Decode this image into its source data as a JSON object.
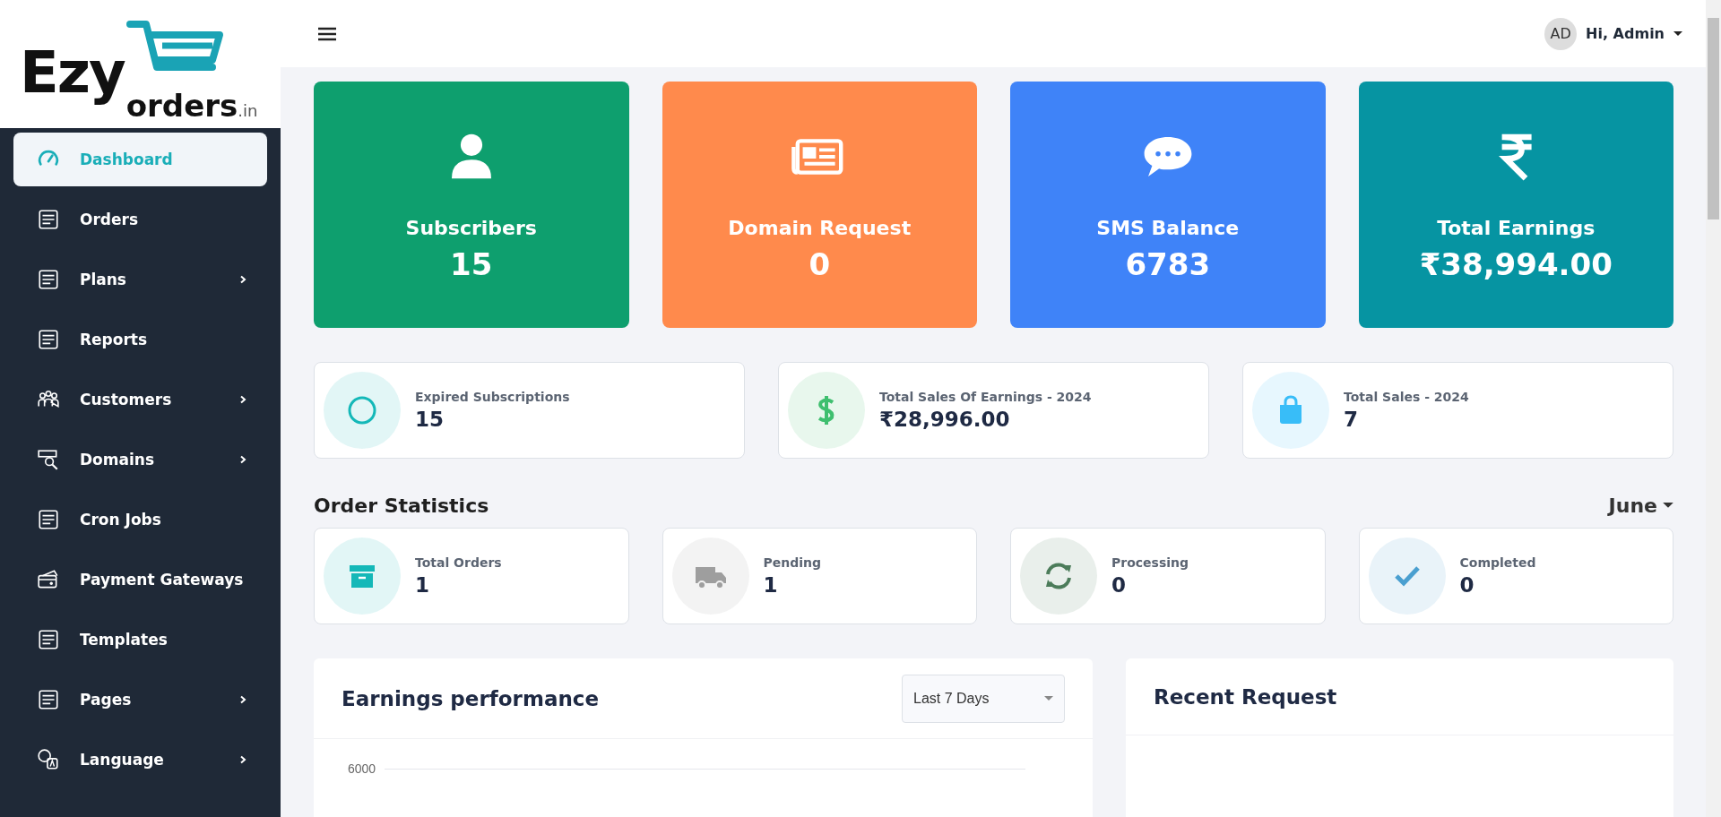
{
  "logo": {
    "word_1": "Ezy",
    "word_2": "orders",
    "suffix": ".in"
  },
  "sidebar": {
    "items": [
      {
        "label": "Dashboard",
        "selected": true,
        "has_submenu": false
      },
      {
        "label": "Orders",
        "selected": false,
        "has_submenu": false
      },
      {
        "label": "Plans",
        "selected": false,
        "has_submenu": true
      },
      {
        "label": "Reports",
        "selected": false,
        "has_submenu": false
      },
      {
        "label": "Customers",
        "selected": false,
        "has_submenu": true
      },
      {
        "label": "Domains",
        "selected": false,
        "has_submenu": true
      },
      {
        "label": "Cron Jobs",
        "selected": false,
        "has_submenu": false
      },
      {
        "label": "Payment Gateways",
        "selected": false,
        "has_submenu": false
      },
      {
        "label": "Templates",
        "selected": false,
        "has_submenu": false
      },
      {
        "label": "Pages",
        "selected": false,
        "has_submenu": true
      },
      {
        "label": "Language",
        "selected": false,
        "has_submenu": true
      }
    ]
  },
  "header": {
    "avatar": "AD",
    "greeting": "Hi, Admin"
  },
  "summary_cards": [
    {
      "label": "Subscribers",
      "value": "15",
      "color": "#0e9f6e"
    },
    {
      "label": "Domain Request",
      "value": "0",
      "color": "#ff8a4c"
    },
    {
      "label": "SMS Balance",
      "value": "6783",
      "color": "#3f83f8"
    },
    {
      "label": "Total Earnings",
      "value": "₹38,994.00",
      "color": "#0694a2"
    }
  ],
  "stats": [
    {
      "label": "Expired Subscriptions",
      "value": "15",
      "color": "#14b8b8"
    },
    {
      "label": "Total Sales Of Earnings - 2024",
      "value": "₹28,996.00",
      "color": "#3fbf6f"
    },
    {
      "label": "Total Sales - 2024",
      "value": "7",
      "color": "#38bdf8"
    }
  ],
  "order_statistics": {
    "title": "Order Statistics",
    "month": "June",
    "items": [
      {
        "label": "Total Orders",
        "value": "1",
        "color": "#14b8b8"
      },
      {
        "label": "Pending",
        "value": "1",
        "color": "#9e9e9e"
      },
      {
        "label": "Processing",
        "value": "0",
        "color": "#4c7c5a"
      },
      {
        "label": "Completed",
        "value": "0",
        "color": "#4a9fd0"
      }
    ]
  },
  "earnings": {
    "title": "Earnings performance",
    "range": "Last 7 Days",
    "y_tick": "6000"
  },
  "recent_request": {
    "title": "Recent Request"
  }
}
